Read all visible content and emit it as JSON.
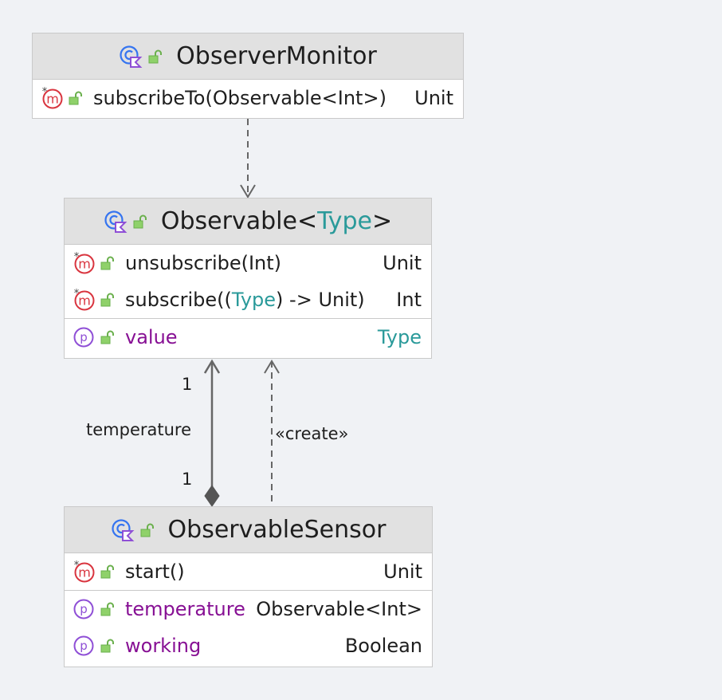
{
  "diagram": {
    "classes": {
      "observer_monitor": {
        "name": "ObserverMonitor",
        "methods": [
          {
            "name": "subscribeTo(Observable<Int>)",
            "type": "Unit"
          }
        ]
      },
      "observable": {
        "name": "Observable",
        "name_lt": "<",
        "type_param": "Type",
        "name_gt": ">",
        "methods": [
          {
            "name": "unsubscribe(Int)",
            "type": "Unit"
          },
          {
            "name_pre": "subscribe((",
            "name_param": "Type",
            "name_post": ") -> Unit)",
            "type": "Int"
          }
        ],
        "properties": [
          {
            "name": "value",
            "type": "Type"
          }
        ]
      },
      "observable_sensor": {
        "name": "ObservableSensor",
        "methods": [
          {
            "name": "start()",
            "type": "Unit"
          }
        ],
        "properties": [
          {
            "name": "temperature",
            "type": "Observable<Int>"
          },
          {
            "name": "working",
            "type": "Boolean"
          }
        ]
      }
    },
    "edges": {
      "composition": {
        "label": "temperature",
        "source_multiplicity": "1",
        "target_multiplicity": "1"
      },
      "create": {
        "label": "«create»"
      }
    },
    "icons": {
      "class": "kotlin-class-icon",
      "method": "abstract-method-icon",
      "property": "property-icon",
      "visibility": "public-lock-icon"
    },
    "colors": {
      "background": "#f0f2f5",
      "header": "#e1e1e1",
      "method_icon": "#d9353f",
      "property_icon": "#8f4fd6",
      "class_icon": "#3574f0",
      "lock_icon": "#6ab04c",
      "property_name": "#871094",
      "type_param": "#2a9a9a"
    }
  }
}
